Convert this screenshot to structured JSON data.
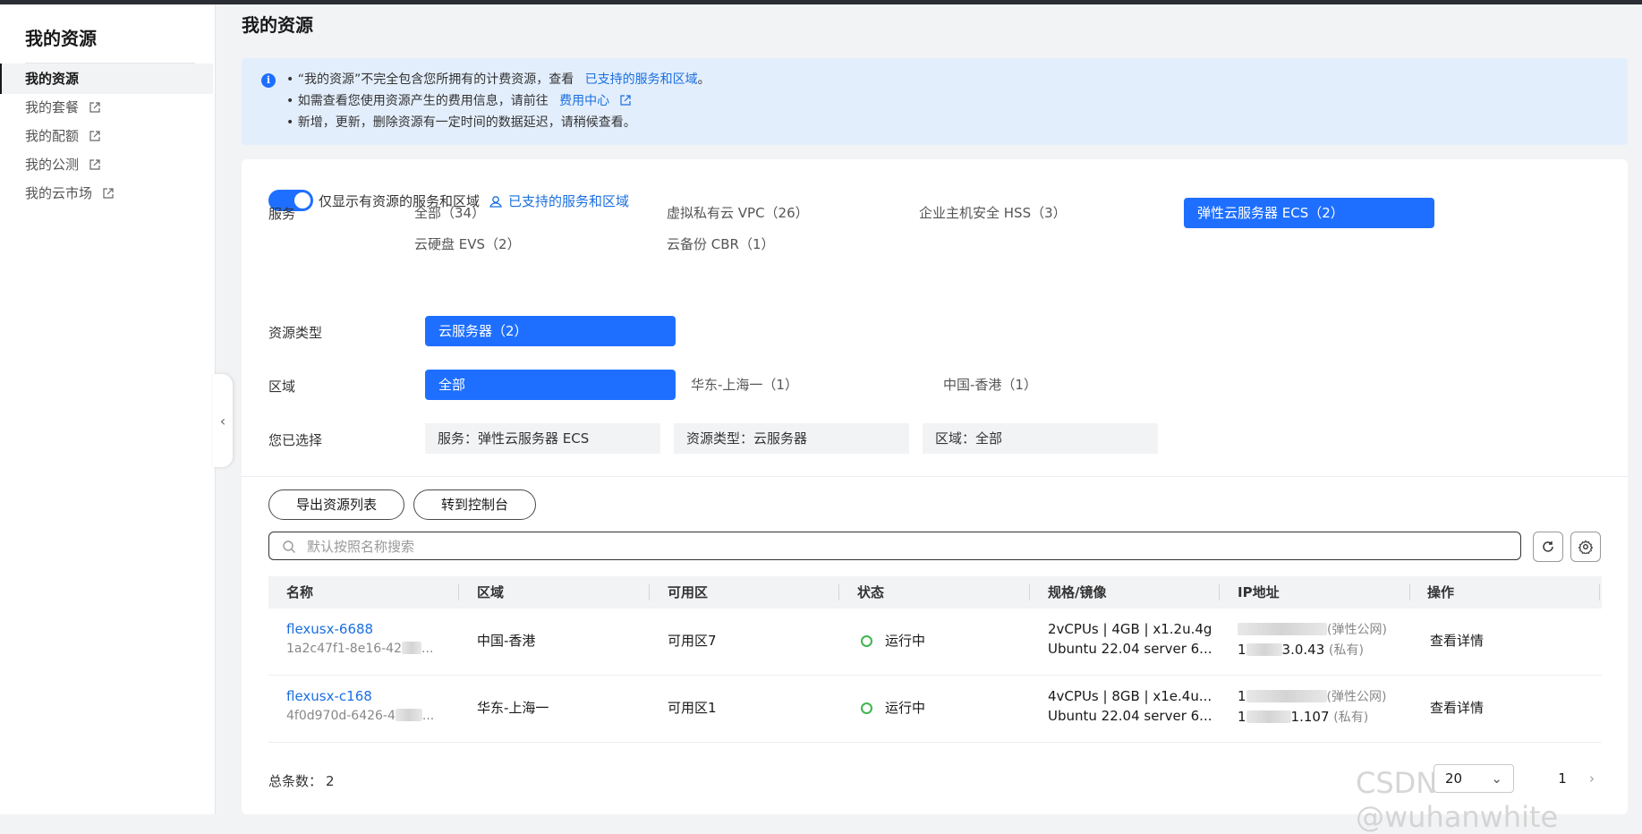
{
  "sidebar": {
    "title": "我的资源",
    "items": [
      {
        "label": "我的资源",
        "external": false
      },
      {
        "label": "我的套餐",
        "external": true
      },
      {
        "label": "我的配额",
        "external": true
      },
      {
        "label": "我的公测",
        "external": true
      },
      {
        "label": "我的云市场",
        "external": true
      }
    ]
  },
  "page": {
    "title": "我的资源"
  },
  "notice": {
    "line1_text": "• “我的资源”不完全包含您所拥有的计费资源，查看",
    "line1_link": "已支持的服务和区域",
    "line1_end": "。",
    "line2_text": "• 如需查看您使用资源产生的费用信息，请前往",
    "line2_link": "费用中心",
    "line3_text": "• 新增，更新，删除资源有一定时间的数据延迟，请稍候查看。"
  },
  "filters": {
    "toggle_label": "仅显示有资源的服务和区域",
    "toggle_on": true,
    "supported_link": "已支持的服务和区域",
    "service_label": "服务",
    "services": [
      "全部（34）",
      "虚拟私有云 VPC（26）",
      "企业主机安全 HSS（3）",
      "弹性云服务器 ECS（2）",
      "云硬盘 EVS（2）",
      "云备份 CBR（1）"
    ],
    "service_selected": "弹性云服务器 ECS（2）",
    "restype_label": "资源类型",
    "restypes": [
      "云服务器（2）"
    ],
    "region_label": "区域",
    "regions": [
      "全部",
      "华东-上海一（1）",
      "中国-香港（1）"
    ],
    "selected_label": "您已选择",
    "chips": [
      "服务：弹性云服务器 ECS",
      "资源类型：云服务器",
      "区域：全部"
    ]
  },
  "actions": {
    "export": "导出资源列表",
    "console": "转到控制台"
  },
  "search": {
    "placeholder": "默认按照名称搜索",
    "value": ""
  },
  "table": {
    "columns": [
      "名称",
      "区域",
      "可用区",
      "状态",
      "规格/镜像",
      "IP地址",
      "操作"
    ],
    "rows": [
      {
        "name": "flexusx-6688",
        "id": "1a2c47f1-8e16-42",
        "id_tail": "...",
        "region": "中国-香港",
        "az": "可用区7",
        "status": "运行中",
        "spec": "2vCPUs | 4GB | x1.2u.4g",
        "image": "Ubuntu 22.04 server 6...",
        "ip_public_prefix": "",
        "ip_public_label": "(弹性公网)",
        "ip_private_prefix": "1",
        "ip_private_tail": "3.0.43",
        "ip_private_label": "(私有)",
        "action": "查看详情"
      },
      {
        "name": "flexusx-c168",
        "id": "4f0d970d-6426-4",
        "id_tail": "...",
        "region": "华东-上海一",
        "az": "可用区1",
        "status": "运行中",
        "spec": "4vCPUs | 8GB | x1e.4u...",
        "image": "Ubuntu 22.04 server 6...",
        "ip_public_prefix": "1",
        "ip_public_label": "(弹性公网)",
        "ip_private_prefix": "1",
        "ip_private_tail": "1.107",
        "ip_private_label": "(私有)",
        "action": "查看详情"
      }
    ]
  },
  "footer": {
    "total_label": "总条数：",
    "total": "2",
    "page_size": "20",
    "page": "1",
    "next": "›"
  },
  "watermark": "CSDN @wuhanwhite",
  "colors": {
    "accent": "#1e6fff",
    "link": "#1a6fe0",
    "status_running": "#3eb650",
    "notice_bg": "#e3eefc"
  }
}
